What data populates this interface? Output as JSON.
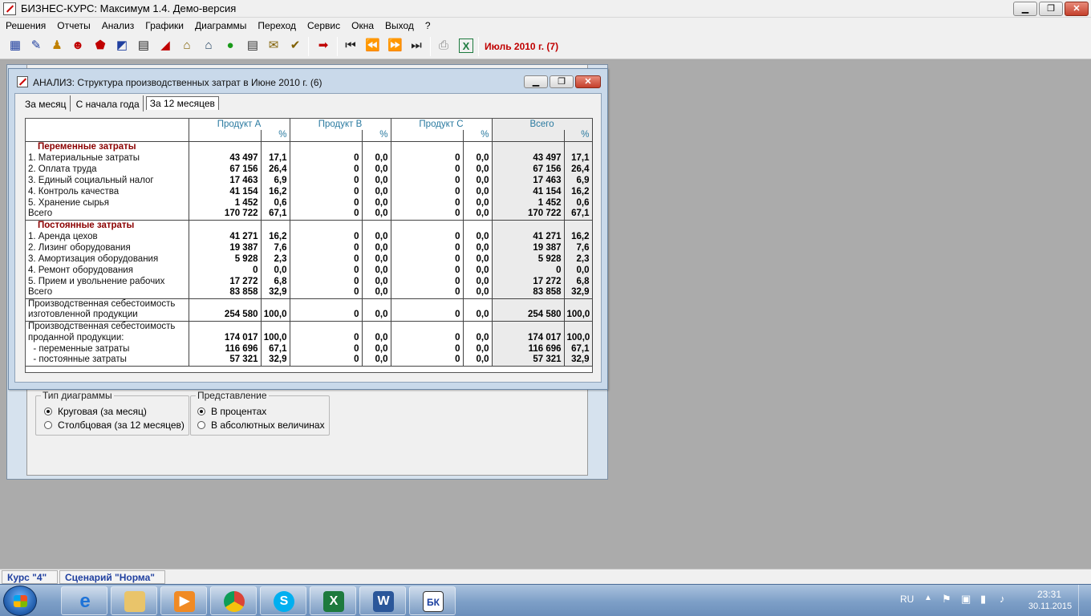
{
  "app": {
    "title": "БИЗНЕС-КУРС: Максимум 1.4. Демо-версия"
  },
  "menu": [
    "Решения",
    "Отчеты",
    "Анализ",
    "Графики",
    "Диаграммы",
    "Переход",
    "Сервис",
    "Окна",
    "Выход",
    "?"
  ],
  "toolbar": {
    "period": "Июль 2010 г. (7)",
    "icons": [
      "decisions-icon",
      "reports-icon",
      "analysis-icon",
      "people-icon",
      "finance-icon",
      "market-icon",
      "table-icon",
      "chart-icon",
      "factory-icon",
      "warehouse-icon",
      "money-bag-icon",
      "document-icon",
      "edit-icon",
      "check-icon",
      "next-step-icon",
      "first-icon",
      "prev-icon",
      "next-icon",
      "last-icon",
      "print-icon",
      "excel-icon"
    ]
  },
  "analysis_window": {
    "title": "АНАЛИЗ: Структура производственных затрат в Июне 2010 г. (6)",
    "tabs": [
      "За месяц",
      "С начала года",
      "За 12 месяцев"
    ],
    "active_tab": "За 12 месяцев",
    "columns": [
      "Продукт A",
      "Продукт B",
      "Продукт C",
      "Всего"
    ],
    "pct_label": "%",
    "sections": [
      {
        "title": "Переменные затраты",
        "rows": [
          {
            "label": "1. Материальные затраты",
            "a": "43 497",
            "ap": "17,1",
            "b": "0",
            "bp": "0,0",
            "c": "0",
            "cp": "0,0",
            "t": "43 497",
            "tp": "17,1"
          },
          {
            "label": "2. Оплата труда",
            "a": "67 156",
            "ap": "26,4",
            "b": "0",
            "bp": "0,0",
            "c": "0",
            "cp": "0,0",
            "t": "67 156",
            "tp": "26,4"
          },
          {
            "label": "3. Единый социальный налог",
            "a": "17 463",
            "ap": "6,9",
            "b": "0",
            "bp": "0,0",
            "c": "0",
            "cp": "0,0",
            "t": "17 463",
            "tp": "6,9"
          },
          {
            "label": "4. Контроль качества",
            "a": "41 154",
            "ap": "16,2",
            "b": "0",
            "bp": "0,0",
            "c": "0",
            "cp": "0,0",
            "t": "41 154",
            "tp": "16,2"
          },
          {
            "label": "5. Хранение сырья",
            "a": "1 452",
            "ap": "0,6",
            "b": "0",
            "bp": "0,0",
            "c": "0",
            "cp": "0,0",
            "t": "1 452",
            "tp": "0,6"
          },
          {
            "label": "Всего",
            "a": "170 722",
            "ap": "67,1",
            "b": "0",
            "bp": "0,0",
            "c": "0",
            "cp": "0,0",
            "t": "170 722",
            "tp": "67,1"
          }
        ]
      },
      {
        "title": "Постоянные затраты",
        "rows": [
          {
            "label": "1. Аренда цехов",
            "a": "41 271",
            "ap": "16,2",
            "b": "0",
            "bp": "0,0",
            "c": "0",
            "cp": "0,0",
            "t": "41 271",
            "tp": "16,2"
          },
          {
            "label": "2. Лизинг оборудования",
            "a": "19 387",
            "ap": "7,6",
            "b": "0",
            "bp": "0,0",
            "c": "0",
            "cp": "0,0",
            "t": "19 387",
            "tp": "7,6"
          },
          {
            "label": "3. Амортизация оборудования",
            "a": "5 928",
            "ap": "2,3",
            "b": "0",
            "bp": "0,0",
            "c": "0",
            "cp": "0,0",
            "t": "5 928",
            "tp": "2,3"
          },
          {
            "label": "4. Ремонт оборудования",
            "a": "0",
            "ap": "0,0",
            "b": "0",
            "bp": "0,0",
            "c": "0",
            "cp": "0,0",
            "t": "0",
            "tp": "0,0"
          },
          {
            "label": "5. Прием и увольнение рабочих",
            "a": "17 272",
            "ap": "6,8",
            "b": "0",
            "bp": "0,0",
            "c": "0",
            "cp": "0,0",
            "t": "17 272",
            "tp": "6,8"
          },
          {
            "label": "Всего",
            "a": "83 858",
            "ap": "32,9",
            "b": "0",
            "bp": "0,0",
            "c": "0",
            "cp": "0,0",
            "t": "83 858",
            "tp": "32,9"
          }
        ]
      }
    ],
    "cost_made": {
      "label1": "Производственная себестоимость",
      "label2": "изготовленной продукции",
      "a": "254 580",
      "ap": "100,0",
      "b": "0",
      "bp": "0,0",
      "c": "0",
      "cp": "0,0",
      "t": "254 580",
      "tp": "100,0"
    },
    "cost_sold": {
      "label1": "Производственная себестоимость",
      "rows": [
        {
          "label": "проданной продукции:",
          "a": "174 017",
          "ap": "100,0",
          "b": "0",
          "bp": "0,0",
          "c": "0",
          "cp": "0,0",
          "t": "174 017",
          "tp": "100,0"
        },
        {
          "label": "  - переменные затраты",
          "a": "116 696",
          "ap": "67,1",
          "b": "0",
          "bp": "0,0",
          "c": "0",
          "cp": "0,0",
          "t": "116 696",
          "tp": "67,1"
        },
        {
          "label": "  - постоянные затраты",
          "a": "57 321",
          "ap": "32,9",
          "b": "0",
          "bp": "0,0",
          "c": "0",
          "cp": "0,0",
          "t": "57 321",
          "tp": "32,9"
        }
      ]
    }
  },
  "chart_window": {
    "diagram_type": {
      "legend": "Тип диаграммы",
      "options": [
        "Круговая (за месяц)",
        "Столбцовая (за 12 месяцев)"
      ],
      "selected": 0
    },
    "view": {
      "legend": "Представление",
      "options": [
        "В процентах",
        "В абсолютных величинах"
      ],
      "selected": 0
    }
  },
  "statusbar": {
    "course": "Курс \"4\"",
    "scenario": "Сценарий \"Норма\""
  },
  "taskbar": {
    "apps": [
      "internet-explorer",
      "file-explorer",
      "media-player",
      "chrome",
      "skype",
      "excel",
      "word",
      "business-course"
    ],
    "lang": "RU",
    "time": "23:31",
    "date": "30.11.2015"
  }
}
